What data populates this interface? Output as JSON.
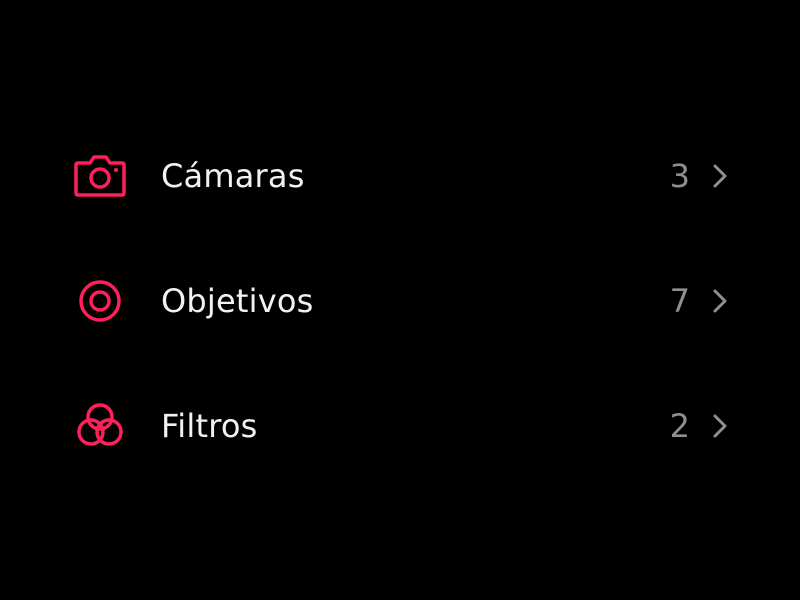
{
  "colors": {
    "background": "#000000",
    "accent": "#ff1f5a",
    "label": "#f2f2f2",
    "count": "#8e8e93",
    "chevron": "#8e8e93"
  },
  "list": {
    "items": [
      {
        "icon": "camera-icon",
        "label": "Cámaras",
        "count": "3"
      },
      {
        "icon": "lens-icon",
        "label": "Objetivos",
        "count": "7"
      },
      {
        "icon": "filters-icon",
        "label": "Filtros",
        "count": "2"
      }
    ]
  }
}
